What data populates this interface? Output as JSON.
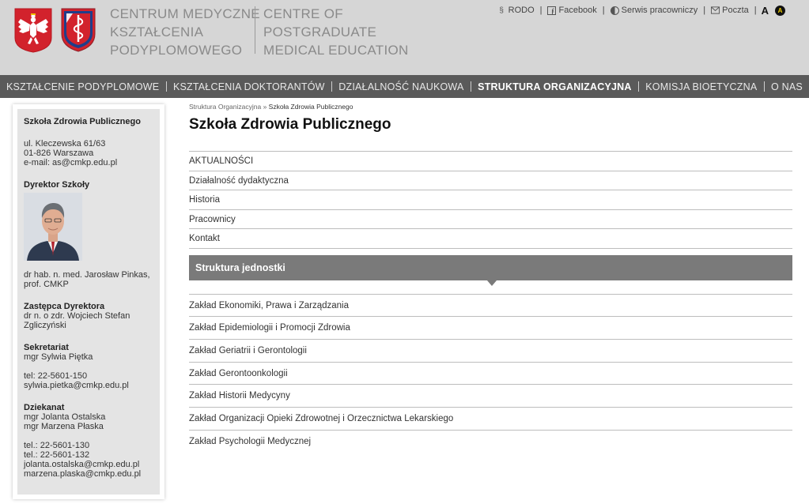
{
  "header": {
    "name_pl": [
      "CENTRUM MEDYCZNE",
      "KSZTAŁCENIA",
      "PODYPLOMOWEGO"
    ],
    "name_en": [
      "CENTRE OF",
      "POSTGRADUATE",
      "MEDICAL EDUCATION"
    ],
    "top_links": [
      {
        "label": "RODO",
        "icon": "paragraph-icon"
      },
      {
        "label": "Facebook",
        "icon": "facebook-icon"
      },
      {
        "label": "Serwis pracowniczy",
        "icon": "half-circle-icon"
      },
      {
        "label": "Poczta",
        "icon": "mail-icon"
      }
    ],
    "font_size_label": "A",
    "contrast_label": "A"
  },
  "nav": {
    "items": [
      "KSZTAŁCENIE PODYPLOMOWE",
      "KSZTAŁCENIA DOKTORANTÓW",
      "DZIAŁALNOŚĆ NAUKOWA",
      "STRUKTURA ORGANIZACYJNA",
      "KOMISJA BIOETYCZNA",
      "O NAS"
    ],
    "active_index": 3
  },
  "sidebar": {
    "title": "Szkoła Zdrowia Publicznego",
    "address": [
      "ul. Kleczewska 61/63",
      "01-826 Warszawa",
      "e-mail: as@cmkp.edu.pl"
    ],
    "director_head": "Dyrektor Szkoły",
    "director_name": [
      "dr hab. n. med. Jarosław Pinkas,",
      "prof. CMKP"
    ],
    "deputy_head": "Zastępca Dyrektora",
    "deputy_name": [
      "dr n. o zdr. Wojciech Stefan",
      "Zgliczyński"
    ],
    "secretariat_head": "Sekretariat",
    "secretariat_name": "mgr Sylwia Piętka",
    "secretariat_contact": [
      "tel: 22-5601-150",
      "sylwia.pietka@cmkp.edu.pl"
    ],
    "deanery_head": "Dziekanat",
    "deanery_names": [
      "mgr Jolanta Ostalska",
      "mgr Marzena Płaska"
    ],
    "deanery_contact": [
      "tel.: 22-5601-130",
      "tel.: 22-5601-132",
      "jolanta.ostalska@cmkp.edu.pl",
      "marzena.plaska@cmkp.edu.pl"
    ]
  },
  "main": {
    "breadcrumb": [
      "Struktura Organizacyjna",
      "»",
      "Szkoła Zdrowia Publicznego"
    ],
    "title": "Szkoła Zdrowia Publicznego",
    "menu": [
      "AKTUALNOŚCI",
      "Działalność dydaktyczna",
      "Historia",
      "Pracownicy",
      "Kontakt"
    ],
    "structure_title": "Struktura jednostki",
    "units": [
      "Zakład Ekonomiki, Prawa i Zarządzania",
      "Zakład Epidemiologii i Promocji Zdrowia",
      "Zakład Geriatrii i Gerontologii",
      "Zakład Gerontoonkologii",
      "Zakład Historii Medycyny",
      "Zakład Organizacji Opieki Zdrowotnej i Orzecznictwa Lekarskiego",
      "Zakład Psychologii Medycznej"
    ]
  },
  "colors": {
    "header_bg": "#d6d6d6",
    "nav_bg": "#5a5a5a",
    "sidebar_bg": "#e4e4e4",
    "structure_bar": "#7a7a7a",
    "emblem_red": "#d2222c",
    "logo_blue": "#1f3e8a"
  }
}
